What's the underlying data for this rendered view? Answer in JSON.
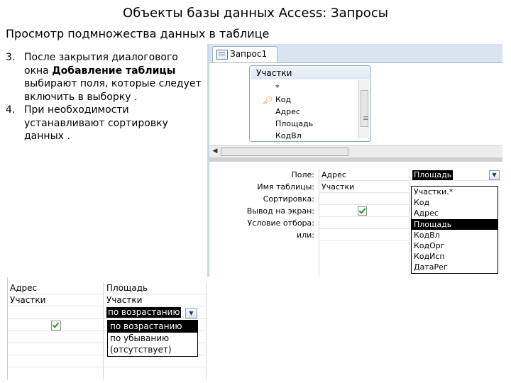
{
  "title": "Объекты базы данных Access: Запросы",
  "subtitle": "Просмотр подмножества данных в таблице",
  "steps": [
    {
      "num": "3.",
      "text_before": "После закрытия диалогового окна ",
      "bold": "Добавление таблицы",
      "text_after": " выбирают поля, которые следует включить в выборку ."
    },
    {
      "num": "4.",
      "text": "При необходимости устанавливают сортировку данных ."
    }
  ],
  "query_window": {
    "tab_label": "Запрос1",
    "table": {
      "name": "Участки",
      "fields": [
        "*",
        "Код",
        "Адрес",
        "Площадь",
        "КодВл"
      ],
      "key_field_icon": "key-icon"
    },
    "row_labels": [
      "Поле:",
      "Имя таблицы:",
      "Сортировка:",
      "Вывод на экран:",
      "Условие отбора:",
      "или:"
    ],
    "column1": {
      "field": "Адрес",
      "table": "Участки",
      "show": true
    },
    "column2": {
      "field": "Площадь"
    },
    "field_dropdown": [
      "Участки.*",
      "Код",
      "Адрес",
      "Площадь",
      "КодВл",
      "КодОрг",
      "КодИсп",
      "ДатаРег"
    ],
    "field_dropdown_selected": "Площадь"
  },
  "small_grid": {
    "column1": {
      "field": "Адрес",
      "table": "Участки",
      "show": true
    },
    "column2": {
      "field": "Площадь",
      "table": "Участки",
      "sort": "по возрастанию"
    },
    "sort_dropdown": [
      "по возрастанию",
      "по убыванию",
      "(отсутствует)"
    ],
    "sort_dropdown_selected": "по возрастанию"
  },
  "colors": {
    "accent_tab_bar": "#d9e4f2",
    "checkmark": "#1e9a2a",
    "selection": "#000000"
  }
}
